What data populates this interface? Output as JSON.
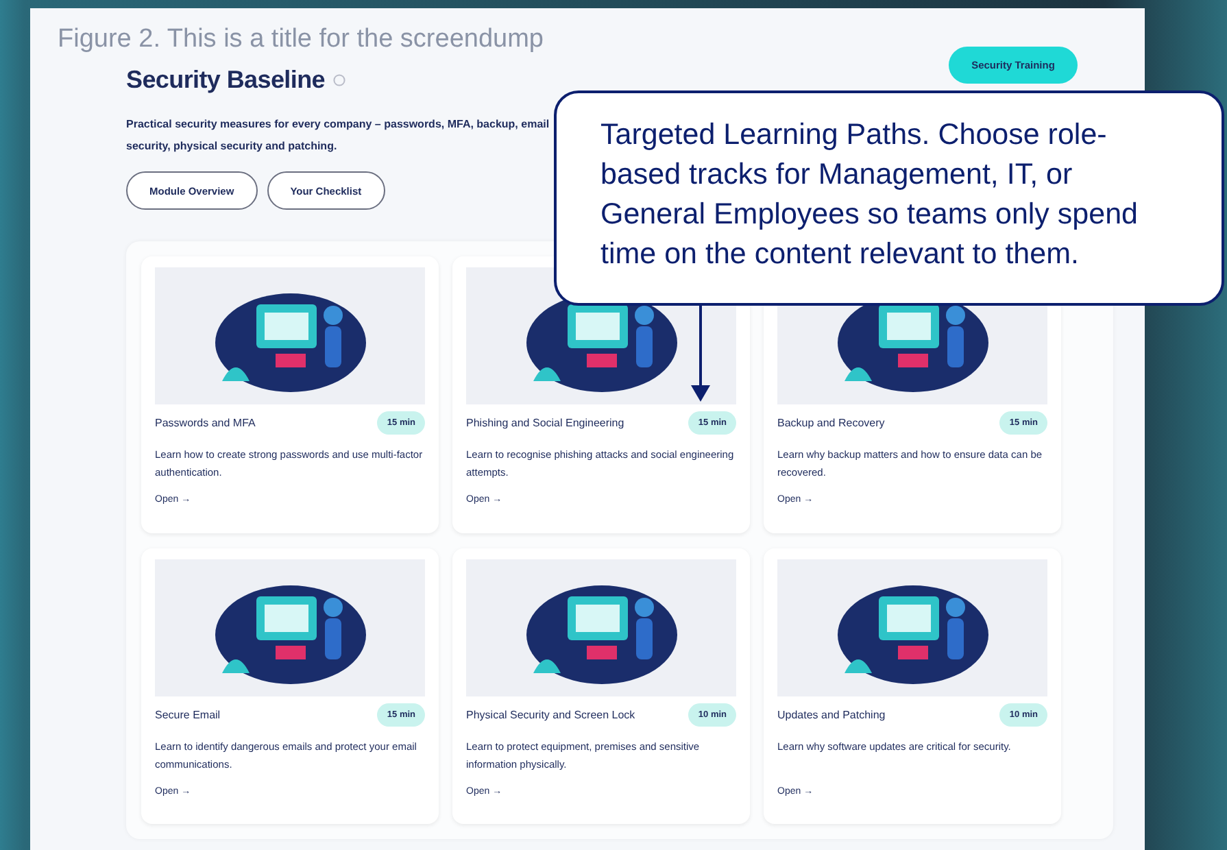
{
  "caption": "Figure 2. This is a title for the screendump",
  "header": {
    "title": "Security Baseline",
    "cta": "Security Training",
    "description": "Practical security measures for every company – passwords, MFA, backup, email security, physical security and patching.",
    "buttons": [
      "Module Overview",
      "Your Checklist"
    ]
  },
  "modules": [
    {
      "title": "Passwords and MFA",
      "duration": "15 min",
      "description": "Learn how to create strong passwords and use multi-factor authentication.",
      "link": "Open →"
    },
    {
      "title": "Phishing and Social Engineering",
      "duration": "15 min",
      "description": "Learn to recognise phishing attacks and social engineering attempts.",
      "link": "Open →"
    },
    {
      "title": "Backup and Recovery",
      "duration": "15 min",
      "description": "Learn why backup matters and how to ensure data can be recovered.",
      "link": "Open →"
    },
    {
      "title": "Secure Email",
      "duration": "15 min",
      "description": "Learn to identify dangerous emails and protect your email communications.",
      "link": "Open →"
    },
    {
      "title": "Physical Security and Screen Lock",
      "duration": "10 min",
      "description": "Learn to protect equipment, premises and sensitive information physically.",
      "link": "Open →"
    },
    {
      "title": "Updates and Patching",
      "duration": "10 min",
      "description": "Learn why software updates are critical for security.",
      "link": "Open →"
    }
  ],
  "callout": {
    "text": "Targeted Learning Paths. Choose role-based tracks for Management, IT, or General Employees so teams only spend time on the content relevant to them."
  }
}
